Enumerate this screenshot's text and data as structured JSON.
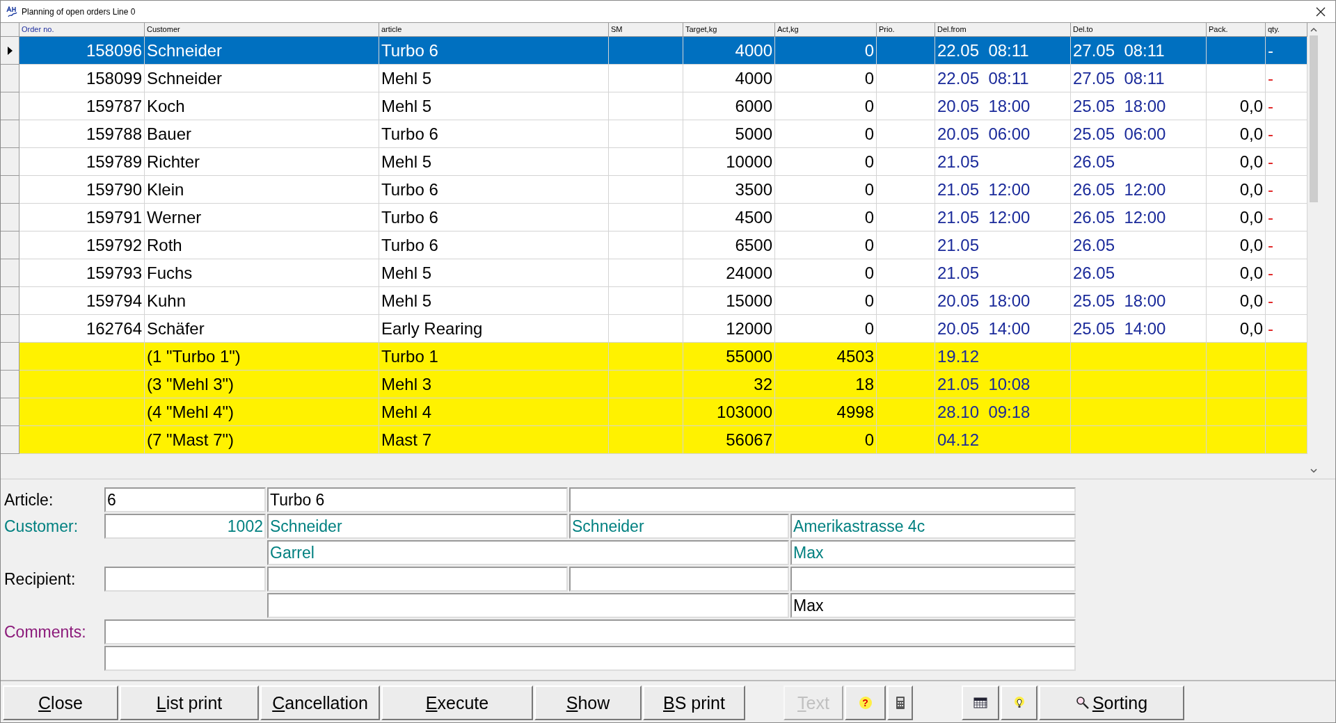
{
  "window": {
    "title": "Planning of open orders Line 0"
  },
  "table": {
    "columns": [
      {
        "label": "Order no.",
        "kind": "order"
      },
      {
        "label": "Customer"
      },
      {
        "label": "article"
      },
      {
        "label": "SM"
      },
      {
        "label": "Target,kg"
      },
      {
        "label": "Act,kg"
      },
      {
        "label": "Prio."
      },
      {
        "label": "Del.from"
      },
      {
        "label": "Del.to"
      },
      {
        "label": "Pack."
      },
      {
        "label": "qty."
      }
    ],
    "rows": [
      {
        "kind": "order",
        "selected": true,
        "order_no": "158096",
        "customer": "Schneider",
        "article": "Turbo 6",
        "target": "4000",
        "act": "0",
        "del_from": "22.05  08:11",
        "del_to": "27.05  08:11",
        "qty": "-"
      },
      {
        "kind": "order",
        "selected": false,
        "order_no": "158099",
        "customer": "Schneider",
        "article": "Mehl 5",
        "target": "4000",
        "act": "0",
        "del_from": "22.05  08:11",
        "del_to": "27.05  08:11",
        "qty": "-"
      },
      {
        "kind": "order",
        "selected": false,
        "order_no": "159787",
        "customer": "Koch",
        "article": "Mehl 5",
        "target": "6000",
        "act": "0",
        "del_from": "20.05  18:00",
        "del_to": "25.05  18:00",
        "pack": "0,0",
        "qty": "-"
      },
      {
        "kind": "order",
        "selected": false,
        "order_no": "159788",
        "customer": "Bauer",
        "article": "Turbo 6",
        "target": "5000",
        "act": "0",
        "del_from": "20.05  06:00",
        "del_to": "25.05  06:00",
        "pack": "0,0",
        "qty": "-"
      },
      {
        "kind": "order",
        "selected": false,
        "order_no": "159789",
        "customer": "Richter",
        "article": "Mehl 5",
        "target": "10000",
        "act": "0",
        "del_from": "21.05",
        "del_to": "26.05",
        "pack": "0,0",
        "qty": "-"
      },
      {
        "kind": "order",
        "selected": false,
        "order_no": "159790",
        "customer": "Klein",
        "article": "Turbo 6",
        "target": "3500",
        "act": "0",
        "del_from": "21.05  12:00",
        "del_to": "26.05  12:00",
        "pack": "0,0",
        "qty": "-"
      },
      {
        "kind": "order",
        "selected": false,
        "order_no": "159791",
        "customer": "Werner",
        "article": "Turbo 6",
        "target": "4500",
        "act": "0",
        "del_from": "21.05  12:00",
        "del_to": "26.05  12:00",
        "pack": "0,0",
        "qty": "-"
      },
      {
        "kind": "order",
        "selected": false,
        "order_no": "159792",
        "customer": "Roth",
        "article": "Turbo 6",
        "target": "6500",
        "act": "0",
        "del_from": "21.05",
        "del_to": "26.05",
        "pack": "0,0",
        "qty": "-"
      },
      {
        "kind": "order",
        "selected": false,
        "order_no": "159793",
        "customer": "Fuchs",
        "article": "Mehl 5",
        "target": "24000",
        "act": "0",
        "del_from": "21.05",
        "del_to": "26.05",
        "pack": "0,0",
        "qty": "-"
      },
      {
        "kind": "order",
        "selected": false,
        "order_no": "159794",
        "customer": "Kuhn",
        "article": "Mehl 5",
        "target": "15000",
        "act": "0",
        "del_from": "20.05  18:00",
        "del_to": "25.05  18:00",
        "pack": "0,0",
        "qty": "-"
      },
      {
        "kind": "order",
        "selected": false,
        "order_no": "162764",
        "customer": "Schäfer",
        "article": "Early Rearing",
        "target": "12000",
        "act": "0",
        "del_from": "20.05  14:00",
        "del_to": "25.05  14:00",
        "pack": "0,0",
        "qty": "-"
      },
      {
        "kind": "silo",
        "selected": false,
        "customer": "(1 \"Turbo 1\")",
        "article": "Turbo 1",
        "target": "55000",
        "act": "4503",
        "del_from": "19.12"
      },
      {
        "kind": "silo",
        "selected": false,
        "customer": "(3 \"Mehl 3\")",
        "article": "Mehl 3",
        "target": "32",
        "act": "18",
        "del_from": "21.05  10:08"
      },
      {
        "kind": "silo",
        "selected": false,
        "customer": "(4 \"Mehl 4\")",
        "article": "Mehl 4",
        "target": "103000",
        "act": "4998",
        "del_from": "28.10  09:18"
      },
      {
        "kind": "silo",
        "selected": false,
        "customer": "(7 \"Mast 7\")",
        "article": "Mast 7",
        "target": "56067",
        "act": "0",
        "del_from": "04.12"
      }
    ]
  },
  "form": {
    "article": {
      "label": "Article:",
      "code": "6",
      "name": "Turbo 6"
    },
    "customer": {
      "label": "Customer:",
      "number": "1002",
      "name": "Schneider",
      "name2": "Schneider",
      "street": "Amerikastrasse 4c",
      "city": "Garrel",
      "contact": "Max"
    },
    "recipient": {
      "label": "Recipient:",
      "contact": "Max"
    },
    "comments": {
      "label": "Comments:"
    }
  },
  "button_groups": [
    [
      {
        "kind": "text",
        "accel": "C",
        "rest": "lose",
        "disabled": false
      },
      {
        "kind": "text",
        "accel": "L",
        "rest": "ist print",
        "disabled": false
      },
      {
        "kind": "text",
        "accel": "C",
        "rest": "ancellation",
        "disabled": false
      },
      {
        "kind": "text",
        "accel": "E",
        "rest": "xecute",
        "disabled": false
      },
      {
        "kind": "text",
        "accel": "S",
        "rest": "how",
        "disabled": false
      },
      {
        "kind": "text",
        "accel": "B",
        "rest": "S print",
        "disabled": false
      }
    ],
    [
      {
        "kind": "text",
        "accel": "T",
        "rest": "ext",
        "disabled": true
      },
      {
        "kind": "help",
        "symbol": "?",
        "disabled": false
      },
      {
        "kind": "calculator",
        "disabled": false
      }
    ],
    [
      {
        "kind": "calendar",
        "disabled": false
      },
      {
        "kind": "tip",
        "disabled": false
      },
      {
        "kind": "sort",
        "accel": "S",
        "rest": "orting",
        "disabled": false
      }
    ]
  ]
}
